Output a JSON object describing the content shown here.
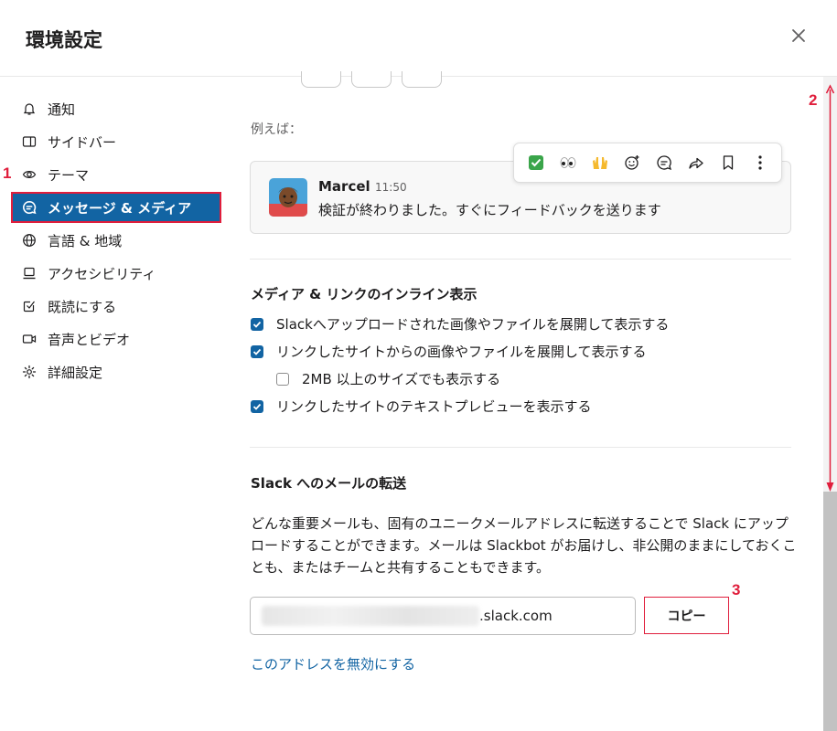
{
  "dialog": {
    "title": "環境設定"
  },
  "sidebar": {
    "items": [
      {
        "label": "通知",
        "icon": "bell-icon"
      },
      {
        "label": "サイドバー",
        "icon": "sidebar-icon"
      },
      {
        "label": "テーマ",
        "icon": "eye-icon"
      },
      {
        "label": "メッセージ & メディア",
        "icon": "message-icon",
        "active": true
      },
      {
        "label": "言語 & 地域",
        "icon": "globe-icon"
      },
      {
        "label": "アクセシビリティ",
        "icon": "laptop-icon"
      },
      {
        "label": "既読にする",
        "icon": "check-square-icon"
      },
      {
        "label": "音声とビデオ",
        "icon": "video-icon"
      },
      {
        "label": "詳細設定",
        "icon": "gear-icon"
      }
    ]
  },
  "annotations": {
    "step1": "1",
    "step2": "2",
    "step3": "3"
  },
  "example": {
    "label": "例えば：",
    "message": {
      "name": "Marcel",
      "time": "11:50",
      "text": "検証が終わりました。すぐにフィードバックを送ります"
    },
    "toolbar": [
      "check-mark-emoji-icon",
      "eyes-emoji-icon",
      "raised-hands-emoji-icon",
      "add-reaction-icon",
      "reply-thread-icon",
      "share-icon",
      "bookmark-icon",
      "more-icon"
    ]
  },
  "inline_media": {
    "title": "メディア & リンクのインライン表示",
    "options": [
      {
        "label": "Slackへアップロードされた画像やファイルを展開して表示する",
        "checked": true
      },
      {
        "label": "リンクしたサイトからの画像やファイルを展開して表示する",
        "checked": true
      },
      {
        "label": "2MB 以上のサイズでも表示する",
        "checked": false
      },
      {
        "label": "リンクしたサイトのテキストプレビューを表示する",
        "checked": true
      }
    ]
  },
  "email_forward": {
    "title": "Slack へのメールの転送",
    "description": "どんな重要メールも、固有のユニークメールアドレスに転送することで Slack にアップロードすることができます。メールは Slackbot がお届けし、非公開のままにしておくことも、またはチームと共有することもできます。",
    "address_suffix": ".slack.com",
    "copy_label": "コピー",
    "disable_link": "このアドレスを無効にする"
  },
  "colors": {
    "accent": "#1264a3",
    "annotation_red": "#e01e3c"
  }
}
